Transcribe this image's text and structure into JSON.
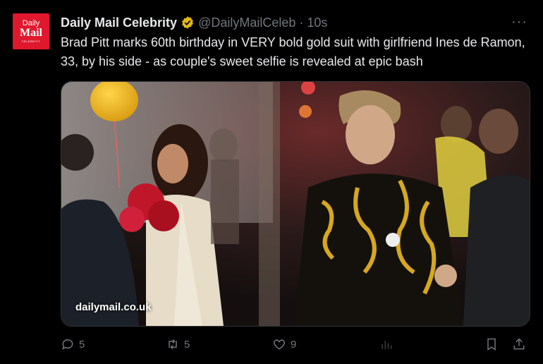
{
  "account": {
    "avatar_line1": "Daily",
    "avatar_line2": "Mail",
    "avatar_line3": "CELEBRITY",
    "name": "Daily Mail Celebrity",
    "handle": "@DailyMailCeleb",
    "separator": "·",
    "time": "10s",
    "more_label": "···"
  },
  "post": {
    "text": "Brad Pitt marks 60th birthday in VERY bold gold suit with girlfriend Ines de Ramon, 33, by his side - as couple's sweet selfie is revealed at epic bash",
    "media_domain": "dailymail.co.uk"
  },
  "actions": {
    "replies": "5",
    "reposts": "5",
    "likes": "9"
  },
  "colors": {
    "accent": "#e0182d",
    "verified": "#e2b719",
    "muted": "#71767b"
  },
  "icons": [
    "verified-badge-icon",
    "reply-icon",
    "repost-icon",
    "like-icon",
    "views-icon",
    "bookmark-icon",
    "share-icon"
  ]
}
